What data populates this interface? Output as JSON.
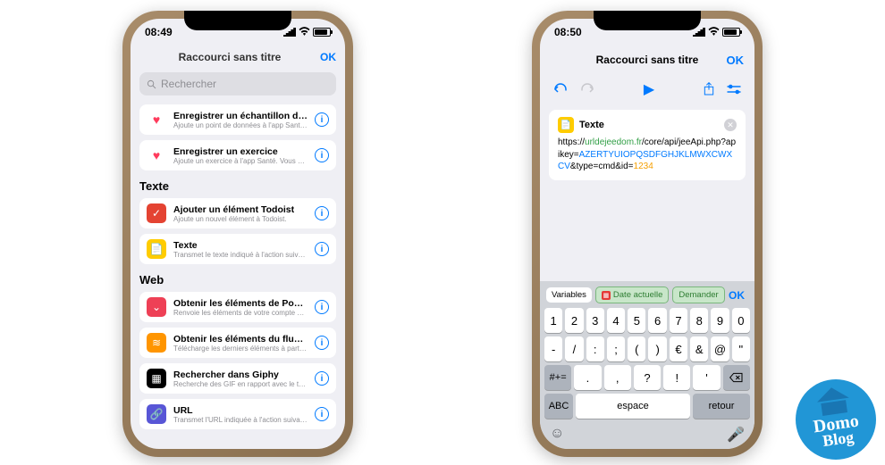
{
  "left": {
    "status_time": "08:49",
    "nav_title": "Raccourci sans titre",
    "nav_ok": "OK",
    "search_placeholder": "Rechercher",
    "top_items": [
      {
        "title": "Enregistrer un échantillon de Santé",
        "sub": "Ajoute un point de données à l'app Santé..."
      },
      {
        "title": "Enregistrer un exercice",
        "sub": "Ajoute un exercice à l'app Santé. Vous pou..."
      }
    ],
    "sections": [
      {
        "header": "Texte",
        "items": [
          {
            "icon": "todoist",
            "title": "Ajouter un élément Todoist",
            "sub": "Ajoute un nouvel élément à Todoist."
          },
          {
            "icon": "text",
            "title": "Texte",
            "sub": "Transmet le texte indiqué à l'action suivante."
          }
        ]
      },
      {
        "header": "Web",
        "items": [
          {
            "icon": "pocket",
            "title": "Obtenir les éléments de Pocket",
            "sub": "Renvoie les éléments de votre compte Poc..."
          },
          {
            "icon": "rss",
            "title": "Obtenir les éléments du flux RSS",
            "sub": "Télécharge les derniers éléments à partir d..."
          },
          {
            "icon": "giphy",
            "title": "Rechercher dans Giphy",
            "sub": "Recherche des GIF en rapport avec le text..."
          },
          {
            "icon": "url",
            "title": "URL",
            "sub": "Transmet l'URL indiquée à l'action suivante."
          }
        ]
      }
    ]
  },
  "right": {
    "status_time": "08:50",
    "nav_title": "Raccourci sans titre",
    "nav_ok": "OK",
    "card_label": "Texte",
    "url_prefix": "https://",
    "url_domain": "urldejeedom.fr",
    "url_path": "/core/api/jeeApi.php?apikey=",
    "url_key": "AZERTYUIOPQSDFGHJKLMWXCWXCV",
    "url_mid": "&type=cmd&id=",
    "url_id": "1234",
    "suggestions": {
      "variables": "Variables",
      "date": "Date actuelle",
      "ask": "Demander",
      "ok": "OK"
    },
    "keyboard": {
      "row1": [
        "1",
        "2",
        "3",
        "4",
        "5",
        "6",
        "7",
        "8",
        "9",
        "0"
      ],
      "row2": [
        "-",
        "/",
        ":",
        ";",
        "(",
        ")",
        "€",
        "&",
        "@",
        "\""
      ],
      "row3_fn": "#+=",
      "row3": [
        ".",
        ",",
        "?",
        "!",
        "'"
      ],
      "abc": "ABC",
      "space": "espace",
      "return": "retour"
    }
  },
  "logo": {
    "line1": "Domo",
    "line2": "Blog"
  }
}
